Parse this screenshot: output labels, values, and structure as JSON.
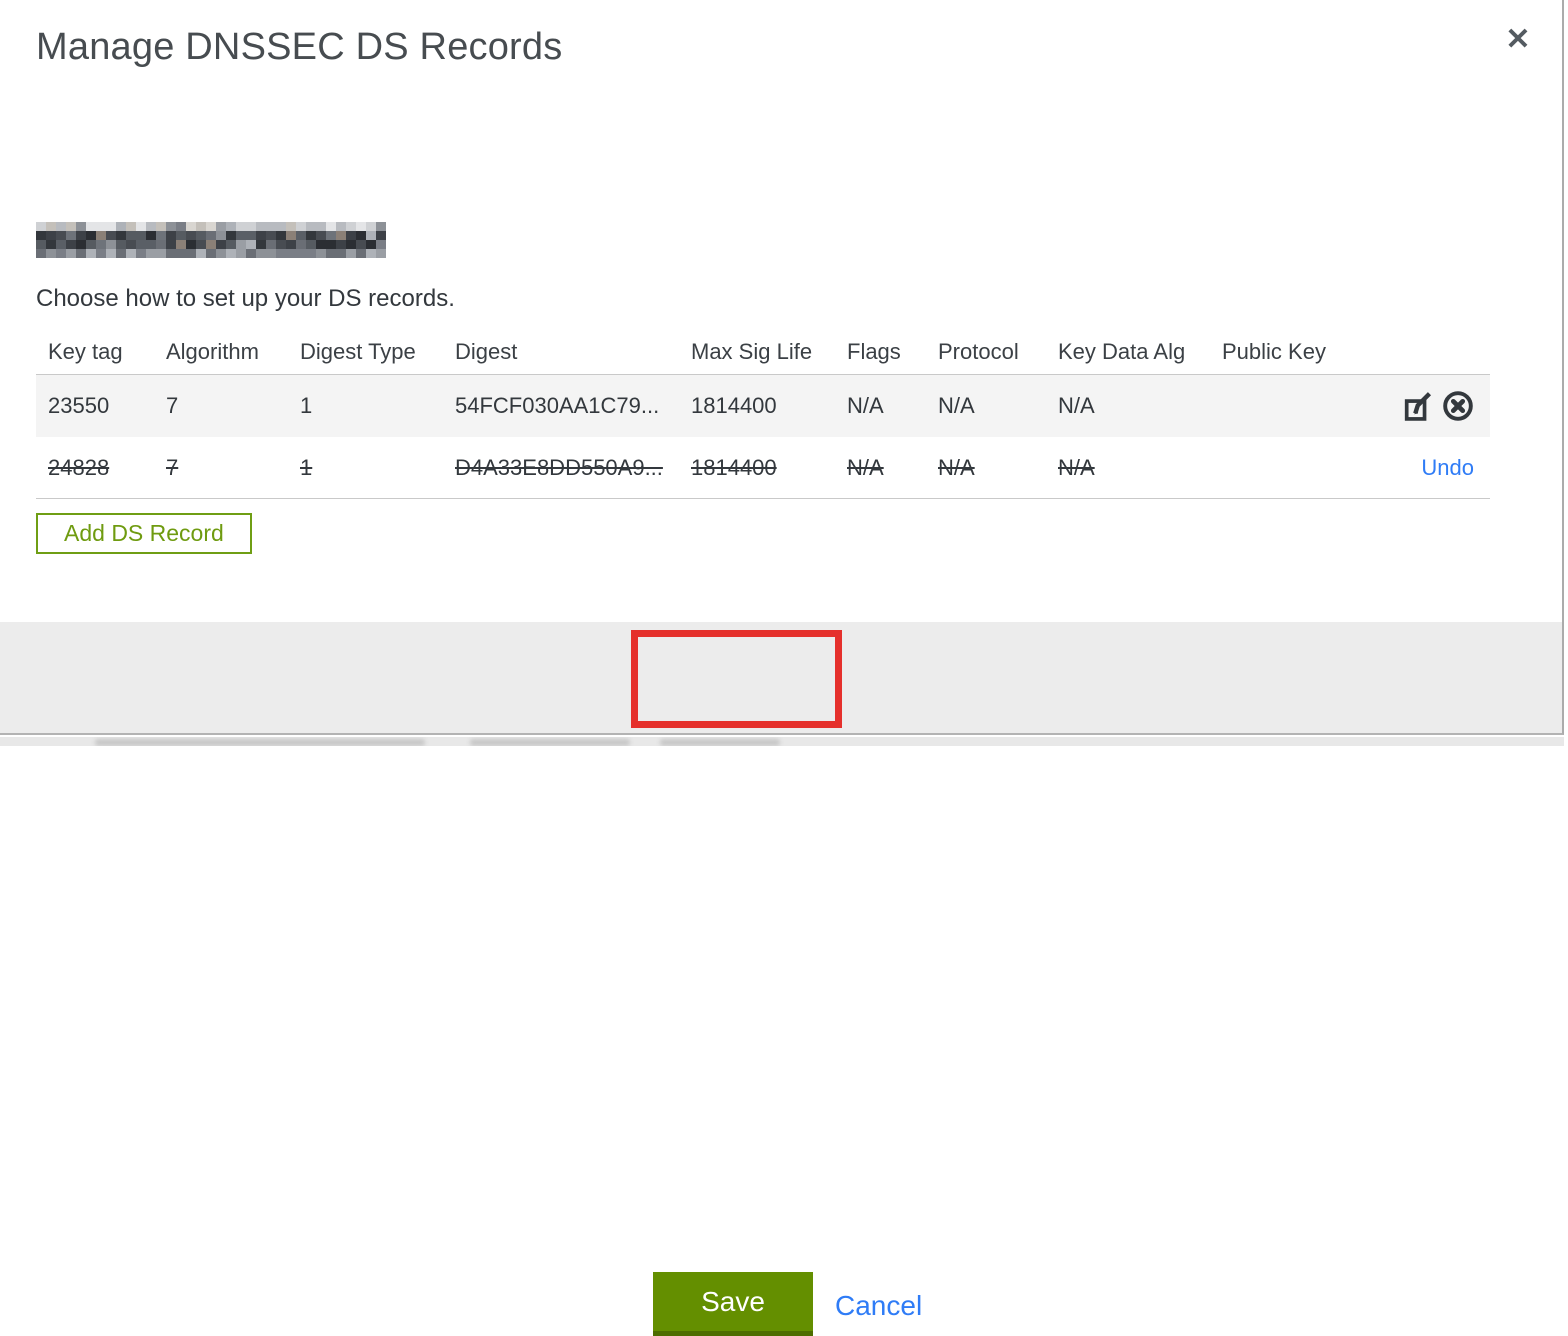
{
  "dialog": {
    "title": "Manage DNSSEC DS Records",
    "instruction": "Choose how to set up your DS records.",
    "domain_redacted": true
  },
  "table": {
    "columns": [
      "Key tag",
      "Algorithm",
      "Digest Type",
      "Digest",
      "Max Sig Life",
      "Flags",
      "Protocol",
      "Key Data Alg",
      "Public Key"
    ],
    "rows": [
      {
        "key_tag": "23550",
        "algorithm": "7",
        "digest_type": "1",
        "digest": "54FCF030AA1C79...",
        "max_sig_life": "1814400",
        "flags": "N/A",
        "protocol": "N/A",
        "key_data_alg": "N/A",
        "public_key": "",
        "state": "active"
      },
      {
        "key_tag": "24828",
        "algorithm": "7",
        "digest_type": "1",
        "digest": "D4A33E8DD550A9...",
        "max_sig_life": "1814400",
        "flags": "N/A",
        "protocol": "N/A",
        "key_data_alg": "N/A",
        "public_key": "",
        "state": "deleted",
        "undo_label": "Undo"
      }
    ]
  },
  "buttons": {
    "add_ds_record": "Add DS Record",
    "save": "Save",
    "cancel": "Cancel"
  },
  "icons": {
    "close": "✕",
    "edit": "pencil-on-square",
    "delete": "x-in-circle"
  },
  "annotation": {
    "type": "highlight-box",
    "target": "save-button",
    "color": "#e5302c"
  },
  "colors": {
    "accent_green": "#648f00",
    "accent_green_dark": "#4d6d00",
    "outline_green": "#6f9e14",
    "link_blue": "#2f7cf6",
    "footer_bg": "#ececec",
    "row_alt_bg": "#f4f4f4",
    "annotation_red": "#e5302c"
  }
}
